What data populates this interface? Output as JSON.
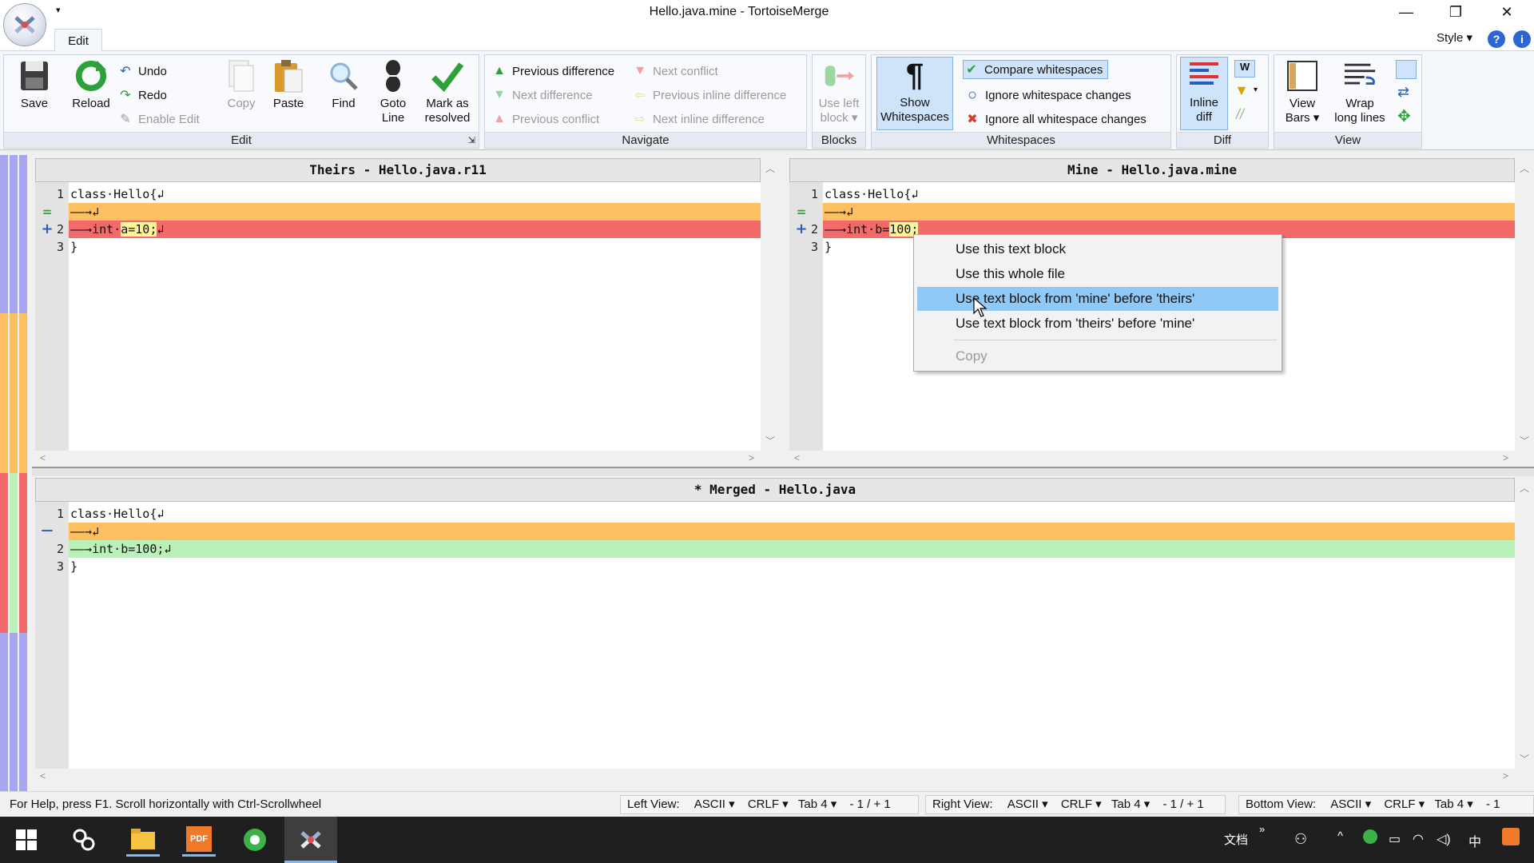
{
  "window": {
    "title": "Hello.java.mine - TortoiseMerge",
    "qa_dropdown": "▾",
    "minimize": "—",
    "restore": "❐",
    "close": "✕"
  },
  "ribbon_tabs": {
    "edit": "Edit",
    "style": "Style ▾",
    "help": "?",
    "info": "i"
  },
  "groups": {
    "edit": {
      "label": "Edit",
      "save": "Save",
      "reload": "Reload",
      "undo": "Undo",
      "redo": "Redo",
      "enable_edit": "Enable Edit",
      "copy": "Copy",
      "paste": "Paste",
      "find": "Find",
      "goto_line": [
        "Goto",
        "Line"
      ],
      "mark_resolved": [
        "Mark as",
        "resolved"
      ]
    },
    "navigate": {
      "label": "Navigate",
      "prev_diff": "Previous difference",
      "next_diff": "Next difference",
      "prev_conflict": "Previous conflict",
      "next_conflict": "Next conflict",
      "prev_inline": "Previous inline difference",
      "next_inline": "Next inline difference"
    },
    "blocks": {
      "label": "Blocks",
      "use_left_block": [
        "Use left",
        "block ▾"
      ]
    },
    "whitespaces": {
      "label": "Whitespaces",
      "show_whitespaces": [
        "Show",
        "Whitespaces"
      ],
      "compare": "Compare whitespaces",
      "ignore_changes": "Ignore whitespace changes",
      "ignore_all": "Ignore all whitespace changes"
    },
    "diff": {
      "label": "Diff",
      "inline_diff": [
        "Inline",
        "diff"
      ]
    },
    "view": {
      "label": "View",
      "view_bars": [
        "View",
        "Bars ▾"
      ],
      "wrap_long_lines": [
        "Wrap",
        "long lines"
      ]
    }
  },
  "panes": {
    "theirs": {
      "header": "Theirs - Hello.java.r11",
      "lines": [
        {
          "num": "1",
          "text": "class·Hello{↲"
        },
        {
          "num": "",
          "text": "——→↲"
        },
        {
          "num": "2",
          "text_before": "——→int·",
          "highlight": "a=10;",
          "text_after": "↲"
        },
        {
          "num": "3",
          "text": "}"
        }
      ]
    },
    "mine": {
      "header": "Mine - Hello.java.mine",
      "lines": [
        {
          "num": "1",
          "text": "class·Hello{↲"
        },
        {
          "num": "",
          "text": "——→↲"
        },
        {
          "num": "2",
          "text_before": "——→int·b=",
          "highlight": "100;",
          "text_after": ""
        },
        {
          "num": "3",
          "text": "}"
        }
      ]
    },
    "merged": {
      "header": "* Merged - Hello.java",
      "lines": [
        {
          "num": "1",
          "text": "class·Hello{↲"
        },
        {
          "num": "",
          "text": "——→↲"
        },
        {
          "num": "2",
          "text": "——→int·b=100;↲"
        },
        {
          "num": "3",
          "text": "}"
        }
      ]
    }
  },
  "gutter_marks": {
    "equal": "=",
    "plus": "+",
    "minus": "—"
  },
  "context_menu": {
    "items": [
      "Use this text block",
      "Use this whole file",
      "Use text block from 'mine' before 'theirs'",
      "Use text block from 'theirs' before 'mine'"
    ],
    "copy": "Copy"
  },
  "statusbar": {
    "help": "For Help, press F1. Scroll horizontally with Ctrl-Scrollwheel",
    "left_view": {
      "label": "Left View:",
      "encoding": "ASCII ▾",
      "eol": "CRLF ▾",
      "tab": "Tab 4 ▾",
      "diff": "- 1 / + 1"
    },
    "right_view": {
      "label": "Right View:",
      "encoding": "ASCII ▾",
      "eol": "CRLF ▾",
      "tab": "Tab 4 ▾",
      "diff": "- 1 / + 1"
    },
    "bottom_view": {
      "label": "Bottom View:",
      "encoding": "ASCII ▾",
      "eol": "CRLF ▾",
      "tab": "Tab 4 ▾",
      "diff": "- 1"
    }
  },
  "taskbar": {
    "tray_text": "文档",
    "tray_chevron": "»",
    "ime": "中",
    "caret": "^"
  },
  "colors": {
    "diff_orange": "#fdbf5f",
    "diff_red": "#f36a6a",
    "diff_green": "#b9f1b9",
    "menu_hover": "#90c8f6"
  }
}
